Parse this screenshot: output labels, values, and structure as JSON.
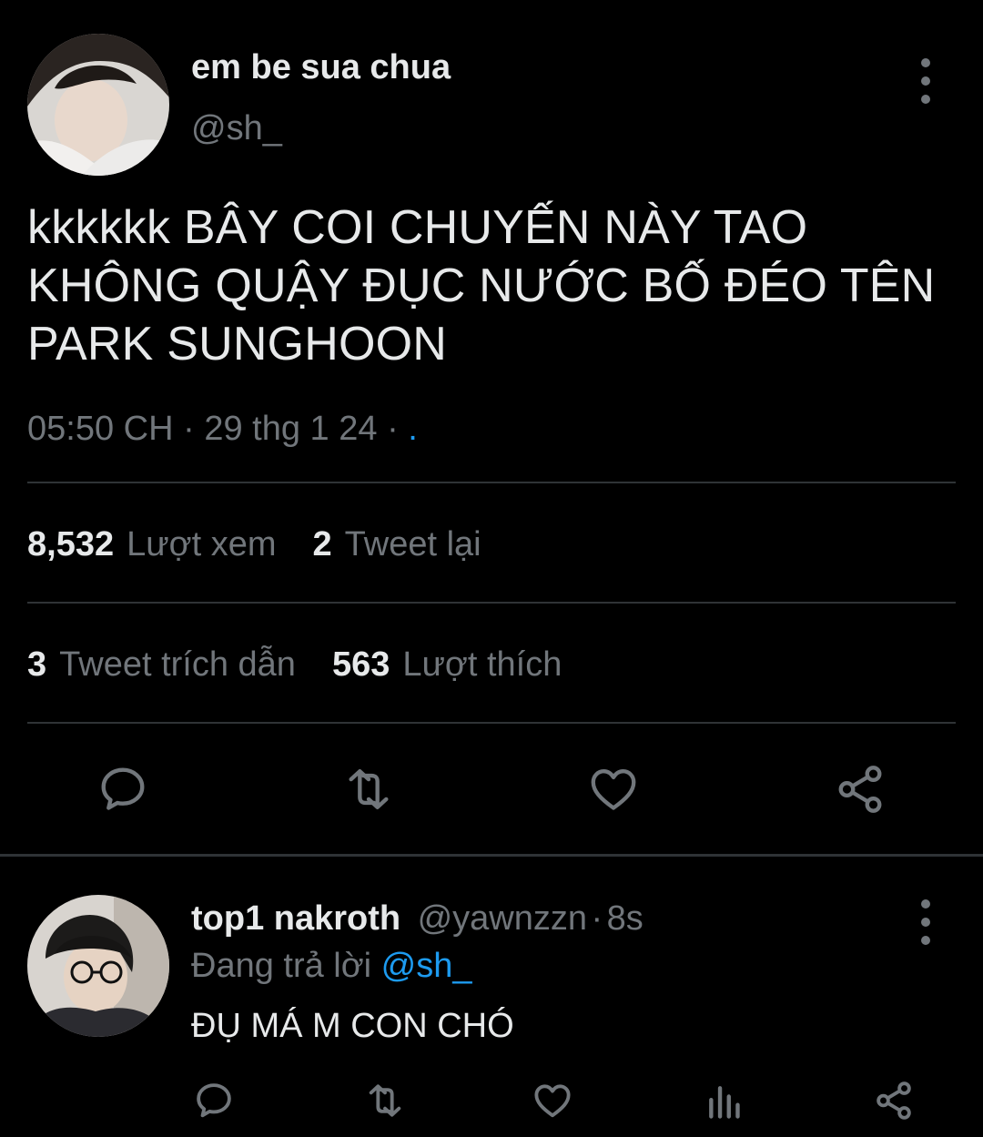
{
  "tweet": {
    "author": {
      "display_name": "em be sua chua",
      "handle": "@sh_"
    },
    "text": "kkkkkk BÂY COI CHUYẾN NÀY TAO KHÔNG QUẬY ĐỤC NƯỚC BỐ ĐÉO TÊN PARK SUNGHOON",
    "time": "05:50 CH",
    "date": "29 thg 1 24",
    "sep": "·",
    "source": ".",
    "stats": {
      "views_count": "8,532",
      "views_label": "Lượt xem",
      "retweets_count": "2",
      "retweets_label": "Tweet lại",
      "quotes_count": "3",
      "quotes_label": "Tweet trích dẫn",
      "likes_count": "563",
      "likes_label": "Lượt thích"
    },
    "actions": [
      "reply-icon",
      "retweet-icon",
      "like-icon",
      "share-icon"
    ]
  },
  "reply": {
    "display_name": "top1 nakroth",
    "handle": "@yawnzzn",
    "sep": "·",
    "age": "8s",
    "replying_prefix": "Đang trả lời",
    "replying_to": "@sh_",
    "text": "ĐỤ MÁ M CON CHÓ",
    "actions": [
      "reply-icon",
      "retweet-icon",
      "like-icon",
      "analytics-icon",
      "share-icon"
    ]
  },
  "colors": {
    "background": "#000000",
    "text": "#e7e9ea",
    "secondary": "#71767b",
    "accent": "#1d9bf0",
    "divider": "#2f3336"
  }
}
